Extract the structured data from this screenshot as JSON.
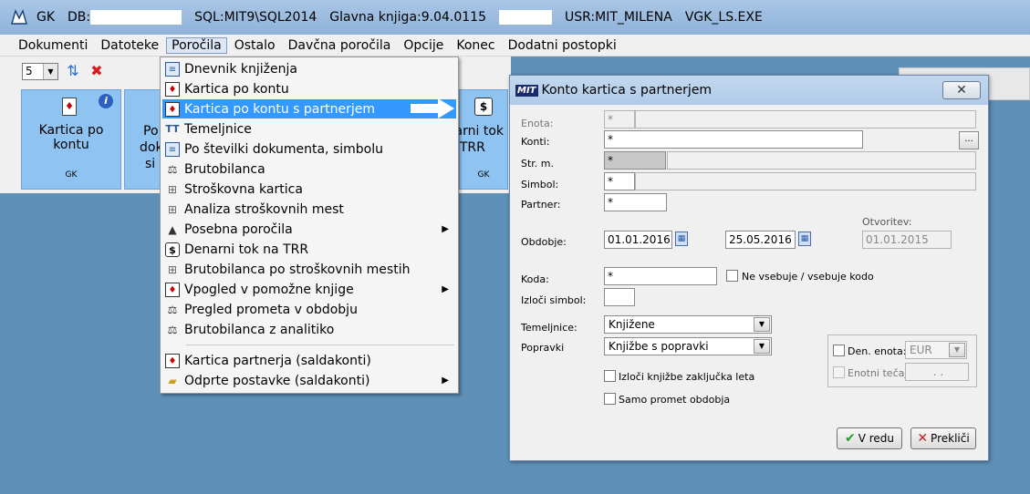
{
  "titlebar": {
    "app": "GK",
    "db_label": "DB:",
    "sql": "SQL:MIT9\\SQL2014",
    "ledger": "Glavna knjiga:9.04.0115",
    "user": "USR:MIT_MILENA",
    "exe": "VGK_LS.EXE"
  },
  "menubar": [
    "Dokumenti",
    "Datoteke",
    "Poročila",
    "Ostalo",
    "Davčna poročila",
    "Opcije",
    "Konec",
    "Dodatni postopki"
  ],
  "toolbar": {
    "page_select": "5"
  },
  "tiles": [
    {
      "label": "Kartica po kontu",
      "sub": "GK"
    },
    {
      "label_lines": [
        "Po",
        "dok",
        "si"
      ]
    },
    {
      "label_lines": [
        "narni tok",
        "TRR"
      ],
      "sub": "GK"
    }
  ],
  "dropdown": {
    "items": [
      "Dnevnik knjiženja",
      "Kartica po kontu",
      "Kartica po kontu s partnerjem",
      "Temeljnice",
      "Po številki dokumenta, simbolu",
      "Brutobilanca",
      "Stroškovna kartica",
      "Analiza stroškovnih mest",
      "Posebna poročila",
      "Denarni tok na TRR",
      "Brutobilanca po stroškovnih mestih",
      "Vpogled v pomožne knjige",
      "Pregled prometa v obdobju",
      "Brutobilanca z analitiko",
      "Kartica partnerja (saldakonti)",
      "Odprte postavke (saldakonti)"
    ]
  },
  "dialog": {
    "logo": "MIT",
    "title": "Konto kartica s partnerjem",
    "close": "✕",
    "labels": {
      "enota": "Enota:",
      "konti": "Konti:",
      "strm": "Str. m.",
      "simbol": "Simbol:",
      "partner": "Partner:",
      "obdobje": "Obdobje:",
      "otvoritev": "Otvoritev:",
      "koda": "Koda:",
      "izloci_simbol": "Izloči simbol:",
      "temeljnice": "Temeljnice:",
      "popravki": "Popravki"
    },
    "values": {
      "enota": "*",
      "konti": "*",
      "strm": "*",
      "simbol": "*",
      "partner": "*",
      "date_from": "01.01.2016",
      "date_to": "25.05.2016",
      "otvoritev": "01.01.2015",
      "koda": "*",
      "izloci_simbol": "",
      "temeljnice": "Knjižene",
      "popravki": "Knjižbe s popravki",
      "currency": "EUR",
      "tecaj": ". ."
    },
    "checkboxes": {
      "ne_vsebuje": "Ne vsebuje / vsebuje kodo",
      "izloci_zakljucka": "Izloči knjižbe zaključka leta",
      "samo_promet": "Samo promet obdobja",
      "den_enota": "Den. enota:",
      "enotni_tecaj": "Enotni tečaj:"
    },
    "buttons": {
      "ok": "V redu",
      "cancel": "Prekliči"
    }
  },
  "colors": {
    "selection": "#3399ff",
    "tile": "#8fc4f2",
    "desktop": "#5e90b8"
  }
}
